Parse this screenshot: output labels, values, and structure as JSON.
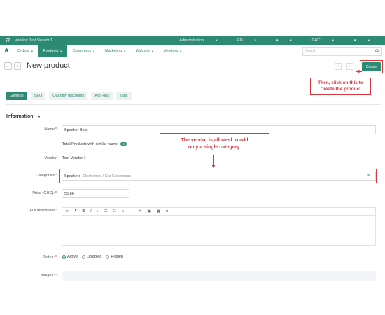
{
  "topbar": {
    "vendor": "Vendor: Test Vendor 1",
    "administration": "Administration",
    "language": "EN",
    "currency": "GHC",
    "icons": [
      "cart-icon",
      "bell-icon",
      "user-icon"
    ]
  },
  "nav": {
    "items": [
      "Orders",
      "Products",
      "Customers",
      "Marketing",
      "Website",
      "Vendors"
    ],
    "search_placeholder": "Search"
  },
  "page": {
    "title": "New product",
    "create_label": "Create"
  },
  "tabs": [
    "General",
    "SEO",
    "Quantity discounts",
    "Add-ons",
    "Tags"
  ],
  "section": {
    "title": "Information"
  },
  "form": {
    "name_label": "Name",
    "name_value": "Speaker Boat",
    "similar_label": "Total Products with similar name:",
    "similar_count": "6",
    "vendor_label": "Vendor",
    "vendor_value": "Test Vendor 1",
    "categories_label": "Categories",
    "category_tag": "Speakers",
    "category_path": "Electronics / Car Electronics",
    "price_label": "Price (GHC):",
    "price_value": "55.00",
    "description_label": "Full description:",
    "status_label": "Status:",
    "status_options": [
      "Active",
      "Disabled",
      "Hidden"
    ],
    "images_label": "Images:"
  },
  "editor": {
    "tools": [
      "<>",
      "¶",
      "B",
      "I",
      "↓",
      "☰",
      "☷",
      "∞",
      "—",
      "⊨",
      "▣",
      "▦",
      "⊙"
    ]
  },
  "annotations": {
    "create_note": "Then, click on this to Create the product",
    "create_note_l1": "Then, click on this to",
    "create_note_l2": "Create the product",
    "category_note_l1": "The vendor is allowed to add",
    "category_note_l2": "only a single category."
  },
  "colors": {
    "accent": "#2d8a73",
    "annotation": "#d9363e"
  }
}
